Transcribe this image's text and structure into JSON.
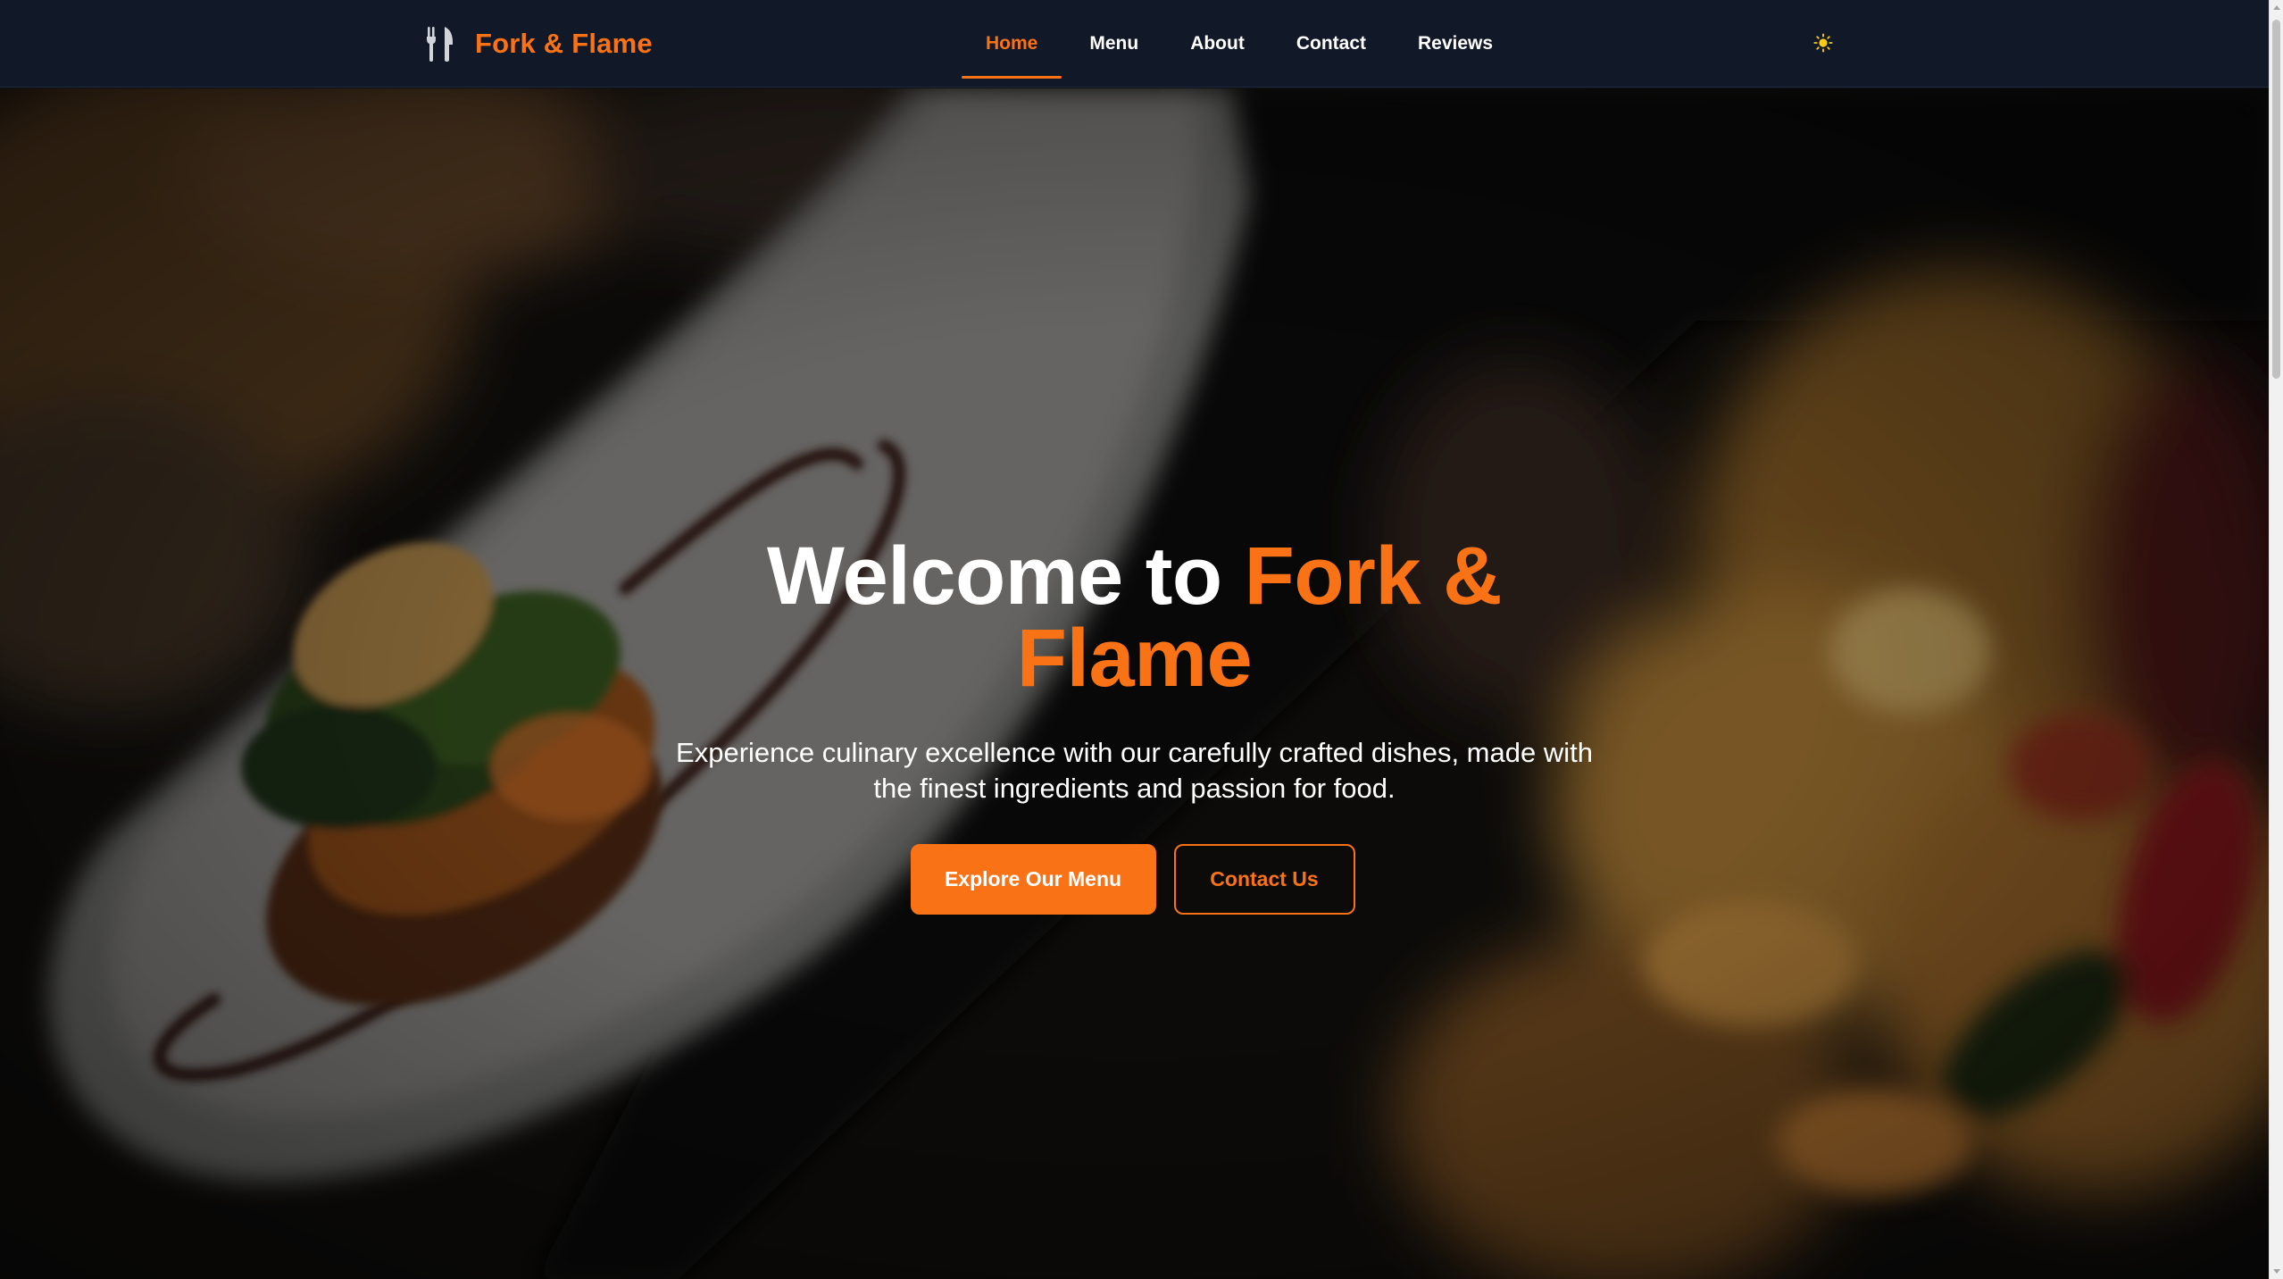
{
  "brand": {
    "name": "Fork & Flame",
    "icon": "utensils-icon",
    "color": "#f97316"
  },
  "nav": {
    "items": [
      {
        "label": "Home",
        "active": true
      },
      {
        "label": "Menu",
        "active": false
      },
      {
        "label": "About",
        "active": false
      },
      {
        "label": "Contact",
        "active": false
      },
      {
        "label": "Reviews",
        "active": false
      }
    ],
    "theme_toggle_icon": "sun-icon"
  },
  "hero": {
    "title_prefix": "Welcome to ",
    "title_accent": "Fork & Flame",
    "subtitle": "Experience culinary excellence with our carefully crafted dishes, made with the finest ingredients and passion for food.",
    "primary_button": "Explore Our Menu",
    "secondary_button": "Contact Us"
  },
  "colors": {
    "accent": "#f97316",
    "navbar_bg": "#111827",
    "text": "#ffffff"
  }
}
